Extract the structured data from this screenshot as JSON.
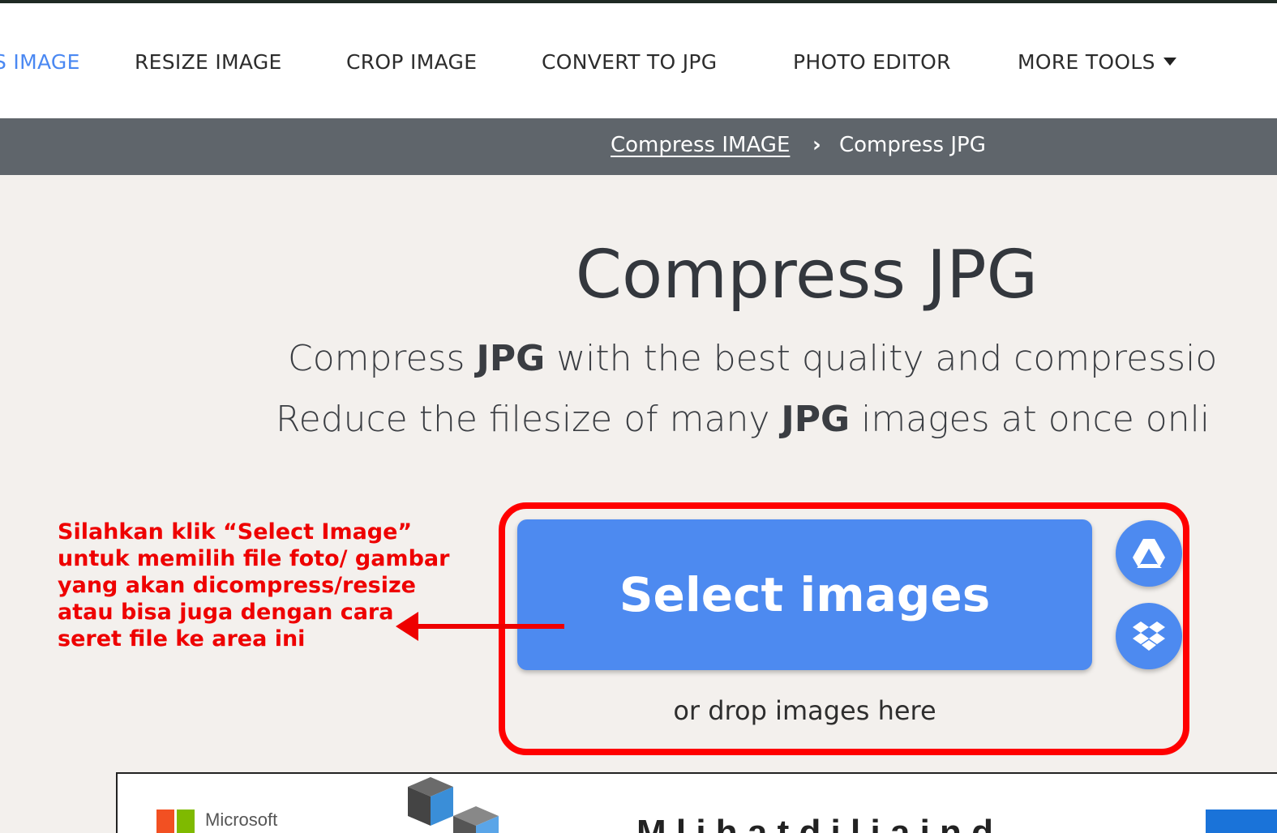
{
  "nav": {
    "items": [
      {
        "label": "S IMAGE",
        "active": true
      },
      {
        "label": "RESIZE IMAGE",
        "active": false
      },
      {
        "label": "CROP IMAGE",
        "active": false
      },
      {
        "label": "CONVERT TO JPG",
        "active": false
      },
      {
        "label": "PHOTO EDITOR",
        "active": false
      },
      {
        "label": "MORE TOOLS",
        "active": false
      }
    ],
    "accent_color": "#4a88f2"
  },
  "breadcrumb": {
    "parent": "Compress IMAGE",
    "separator": "›",
    "current": "Compress JPG"
  },
  "hero": {
    "title": "Compress JPG",
    "line1_pre": "Compress ",
    "line1_bold": "JPG",
    "line1_post": " with the best quality and compressio",
    "line2_pre": "Reduce the filesize of many ",
    "line2_bold": "JPG",
    "line2_post": " images at once onli"
  },
  "upload": {
    "select_label": "Select images",
    "drop_label": "or drop images here",
    "button_color": "#4d8af0",
    "google_drive_icon": "google-drive-icon",
    "dropbox_icon": "dropbox-icon"
  },
  "annotation": {
    "lines": [
      "Silahkan klik “Select Image”",
      "untuk memilih file foto/ gambar",
      "yang akan dicompress/resize",
      "atau bisa juga dengan cara",
      "seret file ke area ini"
    ],
    "color": "#ee0000"
  },
  "ad": {
    "brand": "Microsoft",
    "headline": "M  l  i  h  a  t    d  i  l  i  a  i  n  d"
  }
}
